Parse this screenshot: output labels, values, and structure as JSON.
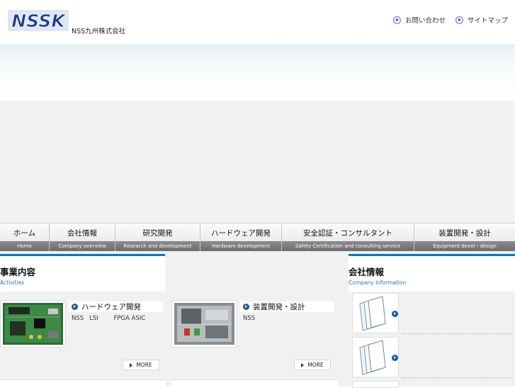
{
  "header": {
    "logo_text": "NSSK",
    "company_name": "NSS九州株式会社",
    "links": [
      "お問い合わせ",
      "サイトマップ"
    ]
  },
  "nav": [
    {
      "jp": "ホーム",
      "en": "Home"
    },
    {
      "jp": "会社情報",
      "en": "Company overview"
    },
    {
      "jp": "研究開発",
      "en": "Research and development"
    },
    {
      "jp": "ハードウェア開発",
      "en": "Hardware development"
    },
    {
      "jp": "安全認証・コンサルタント",
      "en": "Safety Certification and consulting service"
    },
    {
      "jp": "装置開発・設計",
      "en": "Equipment devel・design"
    }
  ],
  "activities": {
    "title": "事業内容",
    "subtitle": "Activities",
    "items": [
      {
        "title": "ハードウェア開発",
        "desc": "NSS   LSI        FPGA ASIC",
        "more": "MORE"
      },
      {
        "title": "装置開発・設計",
        "desc": "NSS",
        "more": "MORE"
      }
    ]
  },
  "company": {
    "title": "会社情報",
    "subtitle": "Company information"
  },
  "colors": {
    "accent": "#0b77b5",
    "brand": "#1d3f8f",
    "bullet": "#1d5b9e"
  }
}
